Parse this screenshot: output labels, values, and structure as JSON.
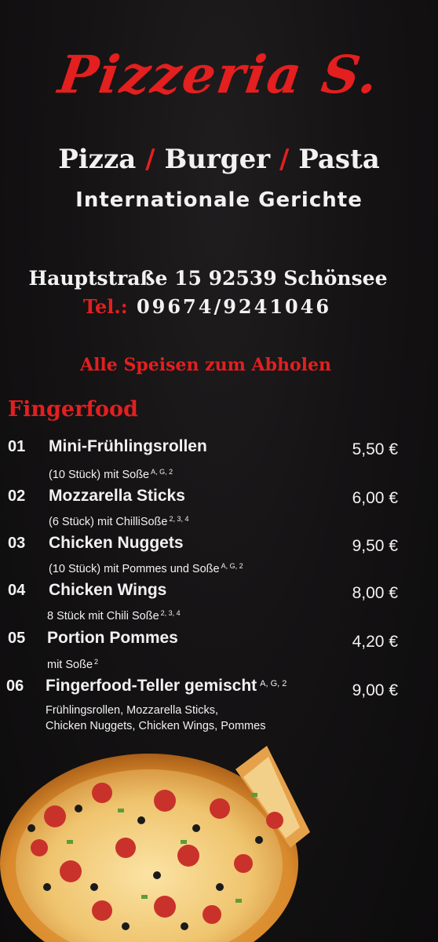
{
  "header": {
    "logo": "Pizzeria S.",
    "subtitle": {
      "part1": "Pizza",
      "sep1": "/",
      "part2": "Burger",
      "sep2": "/",
      "part3": "Pasta"
    },
    "tagline": "Internationale Gerichte",
    "address": "Hauptstraße 15 92539 Schönsee",
    "phone_label": "Tel.:",
    "phone_number": "09674/9241046",
    "pickup_note": "Alle Speisen zum Abholen"
  },
  "section": {
    "title": "Fingerfood"
  },
  "items": [
    {
      "no": "01",
      "name": "Mini-Frühlingsrollen",
      "name_sup": "",
      "desc1": "(10 Stück) mit Soße",
      "desc1_sup": "A, G, 2",
      "desc2": "",
      "price": "5,50 €"
    },
    {
      "no": "02",
      "name": "Mozzarella Sticks",
      "name_sup": "",
      "desc1": "(6 Stück) mit ChilliSoße",
      "desc1_sup": "2, 3, 4",
      "desc2": "",
      "price": "6,00 €"
    },
    {
      "no": "03",
      "name": "Chicken Nuggets",
      "name_sup": "",
      "desc1": "(10 Stück) mit Pommes und Soße",
      "desc1_sup": "A, G, 2",
      "desc2": "",
      "price": "9,50 €"
    },
    {
      "no": "04",
      "name": "Chicken Wings",
      "name_sup": "",
      "desc1": "8 Stück mit Chili Soße",
      "desc1_sup": "2, 3, 4",
      "desc2": "",
      "price": "8,00 €"
    },
    {
      "no": "05",
      "name": "Portion Pommes",
      "name_sup": "",
      "desc1": "mit Soße",
      "desc1_sup": "2",
      "desc2": "",
      "price": "4,20 €"
    },
    {
      "no": "06",
      "name": "Fingerfood-Teller gemischt",
      "name_sup": "A, G, 2",
      "desc1": "Frühlingsrollen, Mozzarella Sticks,",
      "desc1_sup": "",
      "desc2": "Chicken Nuggets, Chicken Wings, Pommes",
      "price": "9,00 €"
    }
  ],
  "colors": {
    "accent": "#e31f1f",
    "text": "#f2f2f2",
    "background": "#151314"
  },
  "icons": {
    "pizza": "pizza-photo"
  }
}
